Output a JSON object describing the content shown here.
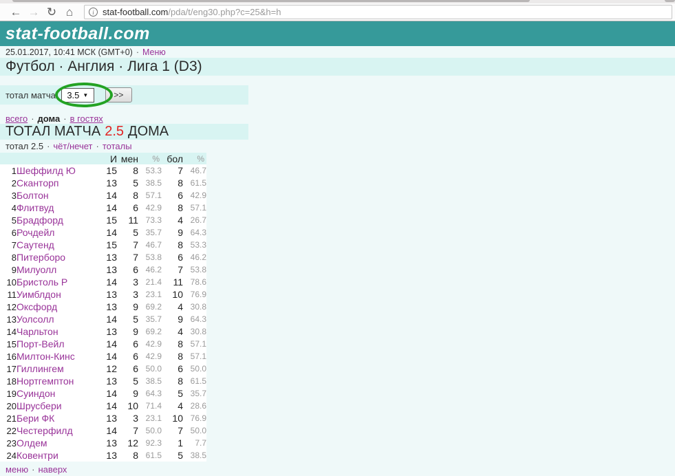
{
  "browser": {
    "url_domain": "stat-football.com",
    "url_path": "/pda/t/eng30.php?c=25&h=h",
    "back": "←",
    "forward": "→",
    "reload": "↻",
    "home": "⌂",
    "info": "i"
  },
  "header": {
    "logo": "stat-football.com"
  },
  "meta_row": {
    "datetime": "25.01.2017, 10:41 МСК (GMT+0)",
    "sep": "·",
    "menu_link": "Меню"
  },
  "page_title": "Футбол · Англия · Лига 1 (D3)",
  "filter": {
    "label": "тотал матча",
    "select_value": "3.5",
    "caret": "▼",
    "submit_label": ">>"
  },
  "scope_links": {
    "all": "всего",
    "home": "дома",
    "away": "в гостях",
    "sep": "·"
  },
  "heading": {
    "prefix": "ТОТАЛ МАТЧА",
    "value": "2.5",
    "suffix": "ДОМА"
  },
  "sub_links": {
    "current": "тотал 2.5",
    "even_odd": "чёт/нечет",
    "totals": "тоталы",
    "sep": "·"
  },
  "table": {
    "headers": [
      "И",
      "мен",
      "%",
      "бол",
      "%"
    ],
    "rows": [
      {
        "rank": 1,
        "team": "Шеффилд Ю",
        "games": 15,
        "under": 8,
        "under_pct": "53.3",
        "over": 7,
        "over_pct": "46.7"
      },
      {
        "rank": 2,
        "team": "Сканторп",
        "games": 13,
        "under": 5,
        "under_pct": "38.5",
        "over": 8,
        "over_pct": "61.5"
      },
      {
        "rank": 3,
        "team": "Болтон",
        "games": 14,
        "under": 8,
        "under_pct": "57.1",
        "over": 6,
        "over_pct": "42.9"
      },
      {
        "rank": 4,
        "team": "Флитвуд",
        "games": 14,
        "under": 6,
        "under_pct": "42.9",
        "over": 8,
        "over_pct": "57.1"
      },
      {
        "rank": 5,
        "team": "Брадфорд",
        "games": 15,
        "under": 11,
        "under_pct": "73.3",
        "over": 4,
        "over_pct": "26.7"
      },
      {
        "rank": 6,
        "team": "Рочдейл",
        "games": 14,
        "under": 5,
        "under_pct": "35.7",
        "over": 9,
        "over_pct": "64.3"
      },
      {
        "rank": 7,
        "team": "Саутенд",
        "games": 15,
        "under": 7,
        "under_pct": "46.7",
        "over": 8,
        "over_pct": "53.3"
      },
      {
        "rank": 8,
        "team": "Питерборо",
        "games": 13,
        "under": 7,
        "under_pct": "53.8",
        "over": 6,
        "over_pct": "46.2"
      },
      {
        "rank": 9,
        "team": "Милуолл",
        "games": 13,
        "under": 6,
        "under_pct": "46.2",
        "over": 7,
        "over_pct": "53.8"
      },
      {
        "rank": 10,
        "team": "Бристоль Р",
        "games": 14,
        "under": 3,
        "under_pct": "21.4",
        "over": 11,
        "over_pct": "78.6"
      },
      {
        "rank": 11,
        "team": "Уимблдон",
        "games": 13,
        "under": 3,
        "under_pct": "23.1",
        "over": 10,
        "over_pct": "76.9"
      },
      {
        "rank": 12,
        "team": "Оксфорд",
        "games": 13,
        "under": 9,
        "under_pct": "69.2",
        "over": 4,
        "over_pct": "30.8"
      },
      {
        "rank": 13,
        "team": "Уолсолл",
        "games": 14,
        "under": 5,
        "under_pct": "35.7",
        "over": 9,
        "over_pct": "64.3"
      },
      {
        "rank": 14,
        "team": "Чарльтон",
        "games": 13,
        "under": 9,
        "under_pct": "69.2",
        "over": 4,
        "over_pct": "30.8"
      },
      {
        "rank": 15,
        "team": "Порт-Вейл",
        "games": 14,
        "under": 6,
        "under_pct": "42.9",
        "over": 8,
        "over_pct": "57.1"
      },
      {
        "rank": 16,
        "team": "Милтон-Кинс",
        "games": 14,
        "under": 6,
        "under_pct": "42.9",
        "over": 8,
        "over_pct": "57.1"
      },
      {
        "rank": 17,
        "team": "Гиллингем",
        "games": 12,
        "under": 6,
        "under_pct": "50.0",
        "over": 6,
        "over_pct": "50.0"
      },
      {
        "rank": 18,
        "team": "Нортгемптон",
        "games": 13,
        "under": 5,
        "under_pct": "38.5",
        "over": 8,
        "over_pct": "61.5"
      },
      {
        "rank": 19,
        "team": "Суиндон",
        "games": 14,
        "under": 9,
        "under_pct": "64.3",
        "over": 5,
        "over_pct": "35.7"
      },
      {
        "rank": 20,
        "team": "Шрусбери",
        "games": 14,
        "under": 10,
        "under_pct": "71.4",
        "over": 4,
        "over_pct": "28.6"
      },
      {
        "rank": 21,
        "team": "Бери ФК",
        "games": 13,
        "under": 3,
        "under_pct": "23.1",
        "over": 10,
        "over_pct": "76.9"
      },
      {
        "rank": 22,
        "team": "Честерфилд",
        "games": 14,
        "under": 7,
        "under_pct": "50.0",
        "over": 7,
        "over_pct": "50.0"
      },
      {
        "rank": 23,
        "team": "Олдем",
        "games": 13,
        "under": 12,
        "under_pct": "92.3",
        "over": 1,
        "over_pct": "7.7"
      },
      {
        "rank": 24,
        "team": "Ковентри",
        "games": 13,
        "under": 8,
        "under_pct": "61.5",
        "over": 5,
        "over_pct": "38.5"
      }
    ]
  },
  "footer": {
    "menu": "меню",
    "top": "наверх",
    "sep": "·"
  },
  "colors": {
    "teal": "#369a9a",
    "band": "#d8f4f2",
    "page_bg": "#eff9f9",
    "link": "#993399",
    "red": "#e22222",
    "muted": "#9a9a9a"
  }
}
